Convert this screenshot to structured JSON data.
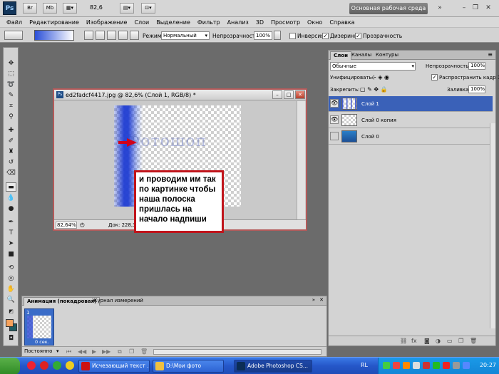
{
  "appbar": {
    "logo": "Ps",
    "zoom": "82,6",
    "workspace": "Основная рабочая среда"
  },
  "menu": [
    "Файл",
    "Редактирование",
    "Изображение",
    "Слои",
    "Выделение",
    "Фильтр",
    "Анализ",
    "3D",
    "Просмотр",
    "Окно",
    "Справка"
  ],
  "options": {
    "mode_label": "Режим:",
    "mode_value": "Нормальный",
    "opacity_label": "Непрозрачность:",
    "opacity_value": "100%",
    "inverse_label": "Инверсия",
    "dither_label": "Дизеринг",
    "transparency_label": "Прозрачность"
  },
  "document": {
    "title": "ed2fadcf4417.jpg @ 82,6% (Слой 1, RGB/8) *",
    "canvas_text": "Фотошоп",
    "zoom": "82,64%",
    "info": "Док: 228,3K/"
  },
  "callout": {
    "text": "и проводим им так по картинке чтобы наша полоска пришлась на начало надпиши"
  },
  "animation": {
    "tab_active": "Анимация (покадровая)",
    "tab_other": "Журнал измерений",
    "frame_number": "1",
    "frame_delay": "0 сек.",
    "loop": "Постоянно"
  },
  "layers": {
    "tabs": [
      "Слои",
      "Каналы",
      "Контуры"
    ],
    "blend_mode": "Обычные",
    "opacity_label": "Непрозрачность:",
    "opacity_value": "100%",
    "unify_label": "Унифицировать:",
    "propagate_label": "Распространить кадр 1",
    "lock_label": "Закрепить:",
    "fill_label": "Заливка:",
    "fill_value": "100%",
    "items": [
      {
        "name": "Слой 1",
        "selected": true
      },
      {
        "name": "Слой 0 копия",
        "selected": false
      },
      {
        "name": "Слой 0",
        "selected": false
      }
    ]
  },
  "taskbar": {
    "items": [
      "Исчезающий текст ...",
      "D:\\Мои фото",
      "Adobe Photoshop CS..."
    ],
    "lang": "RL",
    "clock": "20:27"
  },
  "colors": {
    "foreground": "#f7a25c",
    "background": "#1f5c63",
    "selection": "#3a61b8",
    "callout_border": "#c0141b"
  }
}
